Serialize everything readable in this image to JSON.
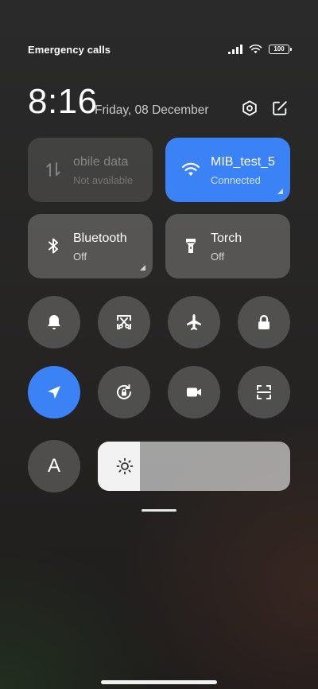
{
  "status_bar": {
    "carrier_text": "Emergency calls o",
    "battery": "100"
  },
  "header": {
    "time": "8:16",
    "date": "Friday, 08 December",
    "settings_icon": "settings-hexagon-icon",
    "edit_icon": "edit-icon"
  },
  "tiles": {
    "mobile_data": {
      "title": "obile data",
      "status": "Not available",
      "icon": "mobile-data-arrows-icon"
    },
    "wifi": {
      "title": "MIB_test_5",
      "status": "Connected",
      "icon": "wifi-icon"
    },
    "bluetooth": {
      "title": "Bluetooth",
      "status": "Off",
      "icon": "bluetooth-icon"
    },
    "torch": {
      "title": "Torch",
      "status": "Off",
      "icon": "flashlight-icon"
    }
  },
  "toggles": [
    {
      "name": "bell-icon",
      "active": false
    },
    {
      "name": "screenshot-icon",
      "active": false
    },
    {
      "name": "airplane-icon",
      "active": false
    },
    {
      "name": "lock-icon",
      "active": false
    },
    {
      "name": "location-icon",
      "active": true
    },
    {
      "name": "rotation-lock-icon",
      "active": false
    },
    {
      "name": "video-camera-icon",
      "active": false
    },
    {
      "name": "scanner-icon",
      "active": false
    }
  ],
  "auto_brightness": {
    "label": "A"
  },
  "brightness": {
    "level": 0.22,
    "icon": "sun-icon"
  },
  "colors": {
    "accent": "#3b82f6",
    "tile": "rgba(255,255,255,0.22)",
    "background": "#262524"
  }
}
